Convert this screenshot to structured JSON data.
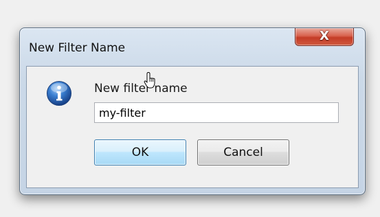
{
  "window": {
    "title": "New Filter Name",
    "close_label": "X"
  },
  "dialog": {
    "icon": "info-icon",
    "prompt": "New filter name",
    "input_value": "my-filter",
    "ok_label": "OK",
    "cancel_label": "Cancel"
  },
  "colors": {
    "close_button": "#c43c27",
    "ok_border": "#3c7fb1",
    "info_blue": "#1f5fb0"
  }
}
